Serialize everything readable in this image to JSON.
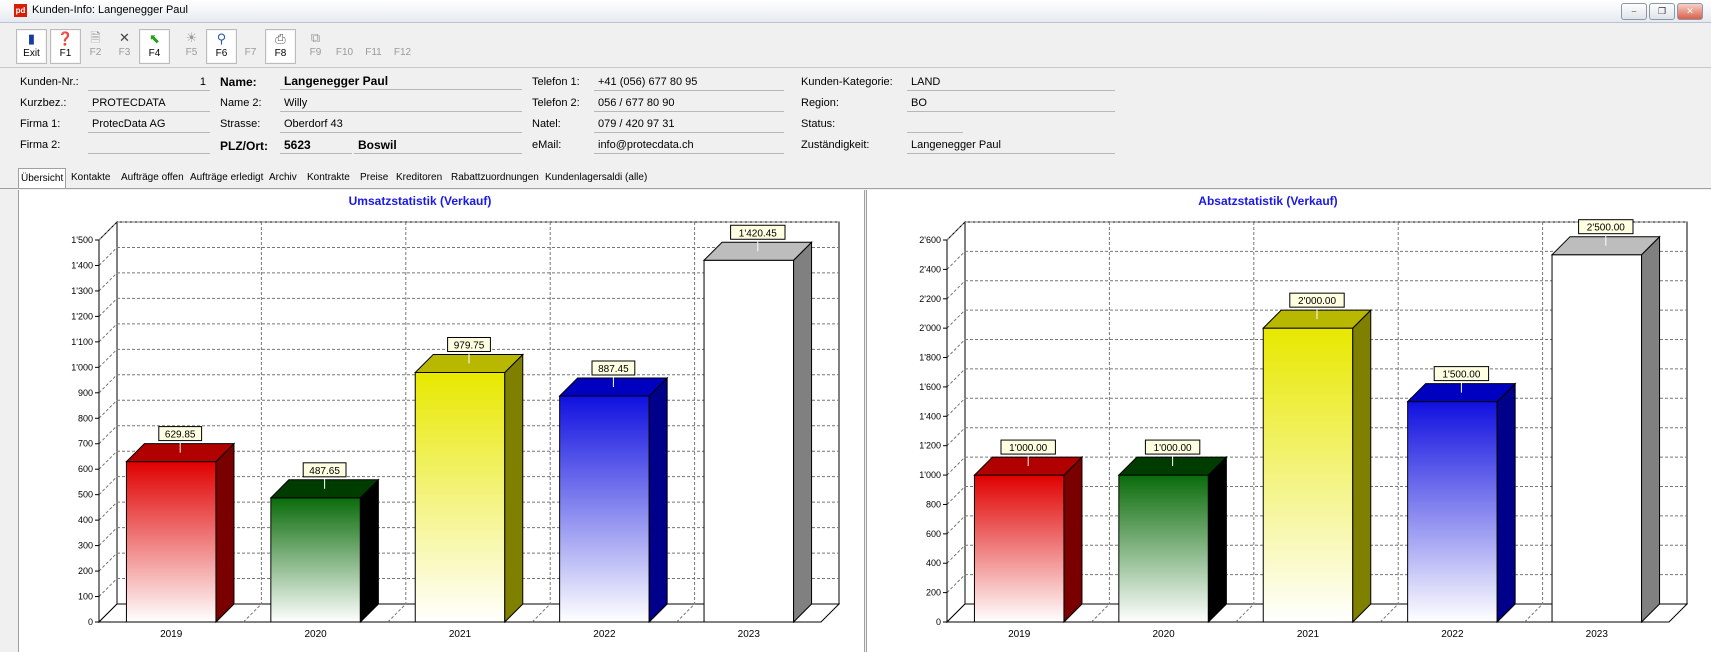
{
  "window": {
    "title": "Kunden-Info: Langenegger  Paul",
    "app_icon": "pd"
  },
  "toolbar": {
    "buttons": [
      {
        "label": "Exit",
        "icon": "exit-icon",
        "enabled": true
      },
      {
        "label": "F1",
        "icon": "help-icon",
        "enabled": true
      },
      {
        "label": "F2",
        "icon": "new-document-icon",
        "enabled": false
      },
      {
        "label": "F3",
        "icon": "delete-icon",
        "enabled": false
      },
      {
        "label": "F4",
        "icon": "green-arrow-icon",
        "enabled": true
      },
      {
        "label": "F5",
        "icon": "lamp-icon",
        "enabled": false
      },
      {
        "label": "F6",
        "icon": "search-icon",
        "enabled": true
      },
      {
        "label": "F7",
        "icon": "",
        "enabled": false
      },
      {
        "label": "F8",
        "icon": "print-icon",
        "enabled": true
      },
      {
        "label": "F9",
        "icon": "copy-icon",
        "enabled": false
      },
      {
        "label": "F10",
        "icon": "",
        "enabled": false
      },
      {
        "label": "F11",
        "icon": "",
        "enabled": false
      },
      {
        "label": "F12",
        "icon": "",
        "enabled": false
      }
    ]
  },
  "customer": {
    "kundennr_label": "Kunden-Nr.:",
    "kundennr": "1",
    "kurzbez_label": "Kurzbez.:",
    "kurzbez": "PROTECDATA",
    "firma1_label": "Firma 1:",
    "firma1": "ProtecData AG",
    "firma2_label": "Firma 2:",
    "firma2": "",
    "name_label": "Name:",
    "name": "Langenegger  Paul",
    "name2_label": "Name 2:",
    "name2": "Willy",
    "strasse_label": "Strasse:",
    "strasse": "Oberdorf 43",
    "plzort_label": "PLZ/Ort:",
    "plz": "5623",
    "ort": "Boswil",
    "telefon1_label": "Telefon 1:",
    "telefon1": "+41 (056) 677 80 95",
    "telefon2_label": "Telefon 2:",
    "telefon2": "056 / 677 80 90",
    "natel_label": "Natel:",
    "natel": "079 / 420 97 31",
    "email_label": "eMail:",
    "email": "info@protecdata.ch",
    "kategorie_label": "Kunden-Kategorie:",
    "kategorie": "LAND",
    "region_label": "Region:",
    "region": "BO",
    "status_label": "Status:",
    "status": "",
    "zustaendig_label": "Zuständigkeit:",
    "zustaendig": "Langenegger Paul"
  },
  "tabs": [
    "Übersicht",
    "Kontakte",
    "Aufträge offen",
    "Aufträge erledigt",
    "Archiv",
    "Kontrakte",
    "Preise",
    "Kreditoren",
    "Rabattzuordnungen",
    "Kundenlagersaldi (alle)"
  ],
  "tabs_selected": 0,
  "chart_data": [
    {
      "type": "bar",
      "title": "Umsatzstatistik (Verkauf)",
      "categories": [
        "2019",
        "2020",
        "2021",
        "2022",
        "2023"
      ],
      "values": [
        629.85,
        487.65,
        979.75,
        887.45,
        1420.45
      ],
      "data_labels": [
        "629.85",
        "487.65",
        "979.75",
        "887.45",
        "1'420.45"
      ],
      "ylim": [
        0,
        1500
      ],
      "yticks": [
        0,
        100,
        200,
        300,
        400,
        500,
        600,
        700,
        800,
        900,
        1000,
        1100,
        1200,
        1300,
        1400,
        1500
      ],
      "ytick_labels": [
        "0",
        "100",
        "200",
        "300",
        "400",
        "500",
        "600",
        "700",
        "800",
        "900",
        "1'000",
        "1'100",
        "1'200",
        "1'300",
        "1'400",
        "1'500"
      ],
      "grid": true,
      "colors": [
        "#e00000",
        "#0a6b0a",
        "#e8e800",
        "#1010e0",
        "#ffffff"
      ],
      "side_colors": [
        "#7a0000",
        "#000000",
        "#808000",
        "#00008a",
        "#808080"
      ],
      "top_colors": [
        "#b00000",
        "#003c00",
        "#b8b800",
        "#0000c0",
        "#bdbdbd"
      ]
    },
    {
      "type": "bar",
      "title": "Absatzstatistik (Verkauf)",
      "categories": [
        "2019",
        "2020",
        "2021",
        "2022",
        "2023"
      ],
      "values": [
        1000,
        1000,
        2000,
        1500,
        2500
      ],
      "data_labels": [
        "1'000.00",
        "1'000.00",
        "2'000.00",
        "1'500.00",
        "2'500.00"
      ],
      "ylim": [
        0,
        2600
      ],
      "yticks": [
        0,
        200,
        400,
        600,
        800,
        1000,
        1200,
        1400,
        1600,
        1800,
        2000,
        2200,
        2400,
        2600
      ],
      "ytick_labels": [
        "0",
        "200",
        "400",
        "600",
        "800",
        "1'000",
        "1'200",
        "1'400",
        "1'600",
        "1'800",
        "2'000",
        "2'200",
        "2'400",
        "2'600"
      ],
      "grid": true,
      "colors": [
        "#e00000",
        "#0a6b0a",
        "#e8e800",
        "#1010e0",
        "#ffffff"
      ],
      "side_colors": [
        "#7a0000",
        "#000000",
        "#808000",
        "#00008a",
        "#808080"
      ],
      "top_colors": [
        "#b00000",
        "#003c00",
        "#b8b800",
        "#0000c0",
        "#bdbdbd"
      ]
    }
  ]
}
